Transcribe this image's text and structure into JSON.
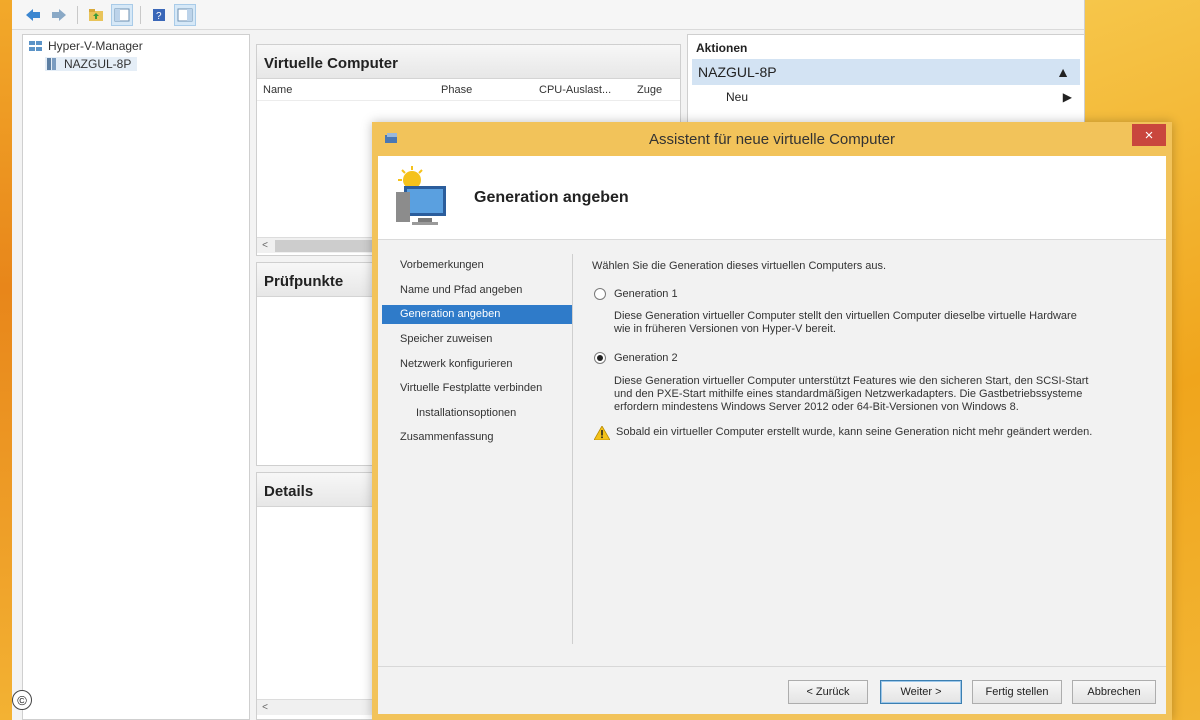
{
  "tree": {
    "root_label": "Hyper-V-Manager",
    "server_label": "NAZGUL-8P"
  },
  "vm_panel": {
    "title": "Virtuelle Computer",
    "columns": [
      "Name",
      "Phase",
      "CPU-Auslast...",
      "Zuge"
    ]
  },
  "checkpoints_panel": {
    "title": "Prüfpunkte"
  },
  "details_panel": {
    "title": "Details"
  },
  "actions_panel": {
    "title": "Aktionen",
    "selected": "NAZGUL-8P",
    "item_new": "Neu"
  },
  "wizard": {
    "title": "Assistent für neue virtuelle Computer",
    "close_label": "×",
    "heading": "Generation angeben",
    "steps": [
      "Vorbemerkungen",
      "Name und Pfad angeben",
      "Generation angeben",
      "Speicher zuweisen",
      "Netzwerk konfigurieren",
      "Virtuelle Festplatte verbinden",
      "Installationsoptionen",
      "Zusammenfassung"
    ],
    "intro": "Wählen Sie die Generation dieses virtuellen Computers aus.",
    "gen1_label": "Generation 1",
    "gen1_desc_line1": "Diese Generation virtueller Computer stellt den virtuellen Computer dieselbe virtuelle Hardware",
    "gen1_desc_line2": "wie in früheren Versionen von Hyper-V bereit.",
    "gen2_label": "Generation 2",
    "gen2_desc_line1": "Diese Generation virtueller Computer unterstützt Features wie den sicheren Start, den SCSI-Start",
    "gen2_desc_line2": "und den PXE-Start mithilfe eines standardmäßigen Netzwerkadapters. Die Gastbetriebssysteme",
    "gen2_desc_line3": "erfordern mindestens Windows Server 2012 oder 64-Bit-Versionen von Windows 8.",
    "warning": "Sobald ein virtueller Computer erstellt wurde, kann seine Generation nicht mehr geändert werden.",
    "selected_generation": "Generation 2",
    "buttons": {
      "back": "< Zurück",
      "next": "Weiter >",
      "finish": "Fertig stellen",
      "cancel": "Abbrechen"
    }
  },
  "watermark": "©",
  "colors": {
    "selection_blue": "#2f7bc9",
    "title_bar": "#f2c35a",
    "close_red": "#c9463d",
    "warning_yellow": "#f4c21a"
  }
}
